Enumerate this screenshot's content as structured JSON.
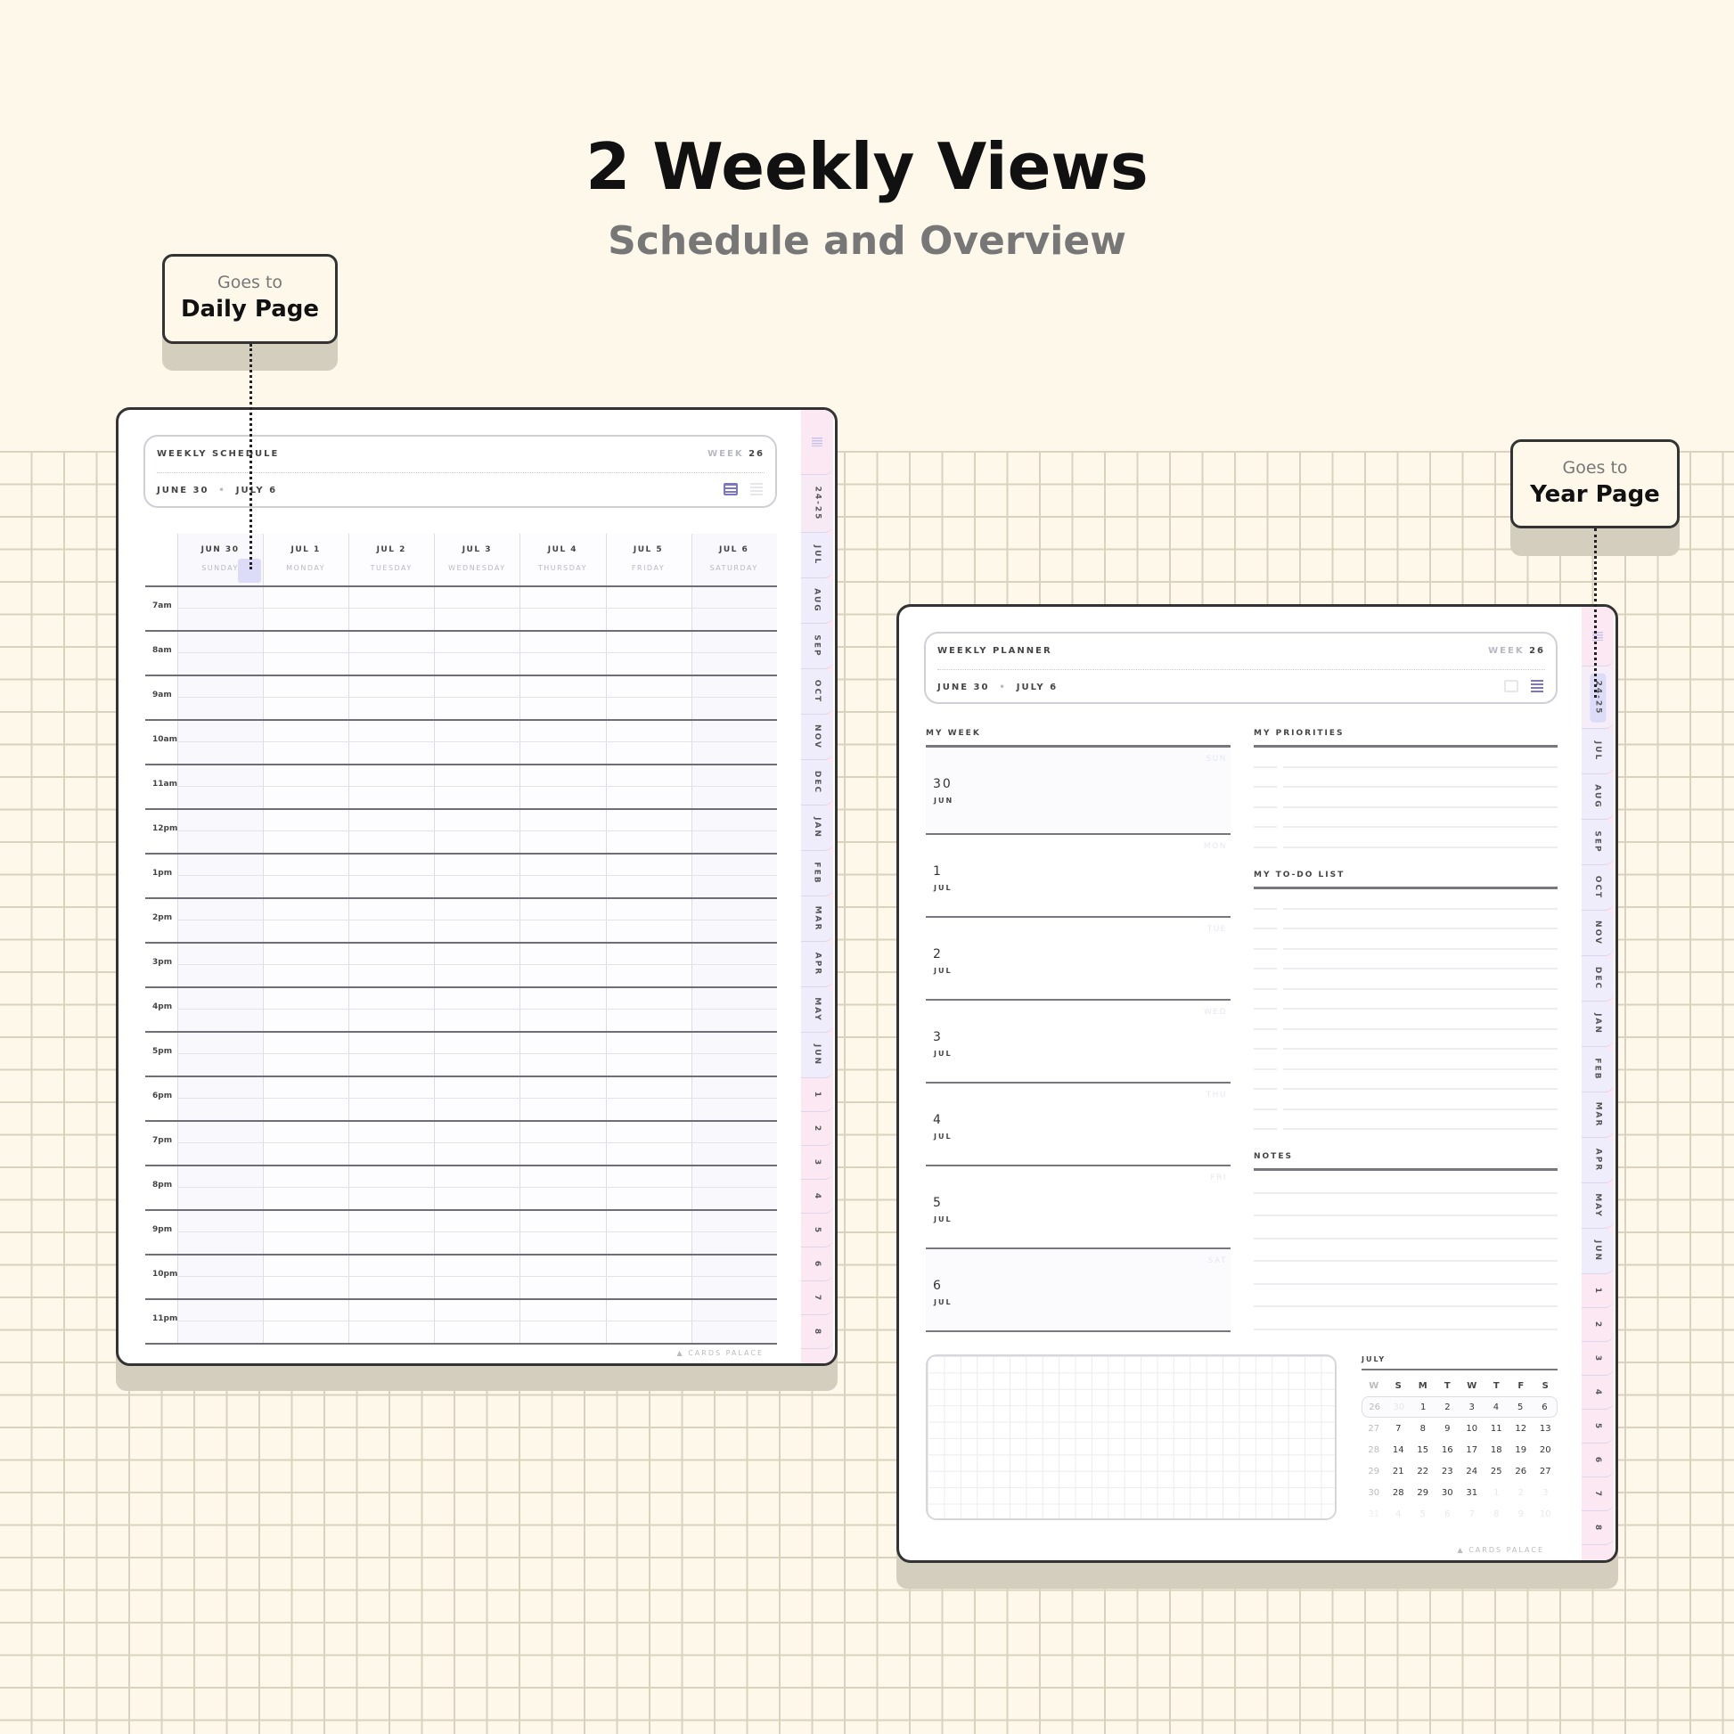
{
  "heading": {
    "title": "2 Weekly Views",
    "subtitle": "Schedule and Overview"
  },
  "callouts": [
    {
      "small": "Goes to",
      "large": "Daily Page"
    },
    {
      "small": "Goes to",
      "large": "Year Page"
    }
  ],
  "tabs": {
    "year": "24-25",
    "months": [
      "JUL",
      "AUG",
      "SEP",
      "OCT",
      "NOV",
      "DEC",
      "JAN",
      "FEB",
      "MAR",
      "APR",
      "MAY",
      "JUN"
    ],
    "numbers": [
      "1",
      "2",
      "3",
      "4",
      "5",
      "6",
      "7",
      "8"
    ],
    "menu_icon": "menu-lines-icon"
  },
  "colors": {
    "background": "#fdf8ea",
    "accent": "#7a76c4",
    "tab_pink": "#fbe8f2",
    "tab_lavender": "#efedfb",
    "highlight": "#dcdcf8"
  },
  "schedule": {
    "title": "WEEKLY SCHEDULE",
    "week_label": "WEEK",
    "week_number": "26",
    "start": "JUNE 30",
    "end": "JULY 6",
    "view_icons": [
      "schedule-view-icon",
      "overview-view-icon"
    ],
    "days": [
      {
        "date": "JUN 30",
        "name": "SUNDAY"
      },
      {
        "date": "JUL 1",
        "name": "MONDAY"
      },
      {
        "date": "JUL 2",
        "name": "TUESDAY"
      },
      {
        "date": "JUL 3",
        "name": "WEDNESDAY"
      },
      {
        "date": "JUL 4",
        "name": "THURSDAY"
      },
      {
        "date": "JUL 5",
        "name": "FRIDAY"
      },
      {
        "date": "JUL 6",
        "name": "SATURDAY"
      }
    ],
    "hours": [
      "7am",
      "8am",
      "9am",
      "10am",
      "11am",
      "12pm",
      "1pm",
      "2pm",
      "3pm",
      "4pm",
      "5pm",
      "6pm",
      "7pm",
      "8pm",
      "9pm",
      "10pm",
      "11pm"
    ],
    "brand": "CARDS PALACE"
  },
  "planner": {
    "title": "WEEKLY PLANNER",
    "week_label": "WEEK",
    "week_number": "26",
    "start": "JUNE 30",
    "end": "JULY 6",
    "my_week": "MY WEEK",
    "priorities": "MY PRIORITIES",
    "todo": "MY TO-DO LIST",
    "notes": "NOTES",
    "days": [
      {
        "num": "30",
        "mon": "JUN",
        "wd": "SUN"
      },
      {
        "num": "1",
        "mon": "JUL",
        "wd": "MON"
      },
      {
        "num": "2",
        "mon": "JUL",
        "wd": "TUE"
      },
      {
        "num": "3",
        "mon": "JUL",
        "wd": "WED"
      },
      {
        "num": "4",
        "mon": "JUL",
        "wd": "THU"
      },
      {
        "num": "5",
        "mon": "JUL",
        "wd": "FRI"
      },
      {
        "num": "6",
        "mon": "JUL",
        "wd": "SAT"
      }
    ],
    "calendar": {
      "month": "JULY",
      "headers": [
        "W",
        "S",
        "M",
        "T",
        "W",
        "T",
        "F",
        "S"
      ],
      "weeks": [
        {
          "w": "26",
          "days": [
            [
              "30",
              1
            ],
            [
              "1",
              0
            ],
            [
              "2",
              0
            ],
            [
              "3",
              0
            ],
            [
              "4",
              0
            ],
            [
              "5",
              0
            ],
            [
              "6",
              0
            ]
          ],
          "current": true
        },
        {
          "w": "27",
          "days": [
            [
              "7",
              0
            ],
            [
              "8",
              0
            ],
            [
              "9",
              0
            ],
            [
              "10",
              0
            ],
            [
              "11",
              0
            ],
            [
              "12",
              0
            ],
            [
              "13",
              0
            ]
          ]
        },
        {
          "w": "28",
          "days": [
            [
              "14",
              0
            ],
            [
              "15",
              0
            ],
            [
              "16",
              0
            ],
            [
              "17",
              0
            ],
            [
              "18",
              0
            ],
            [
              "19",
              0
            ],
            [
              "20",
              0
            ]
          ]
        },
        {
          "w": "29",
          "days": [
            [
              "21",
              0
            ],
            [
              "22",
              0
            ],
            [
              "23",
              0
            ],
            [
              "24",
              0
            ],
            [
              "25",
              0
            ],
            [
              "26",
              0
            ],
            [
              "27",
              0
            ]
          ]
        },
        {
          "w": "30",
          "days": [
            [
              "28",
              0
            ],
            [
              "29",
              0
            ],
            [
              "30",
              0
            ],
            [
              "31",
              0
            ],
            [
              "1",
              1
            ],
            [
              "2",
              1
            ],
            [
              "3",
              1
            ]
          ]
        },
        {
          "w": "31",
          "days": [
            [
              "4",
              1
            ],
            [
              "5",
              1
            ],
            [
              "6",
              1
            ],
            [
              "7",
              1
            ],
            [
              "8",
              1
            ],
            [
              "9",
              1
            ],
            [
              "10",
              1
            ]
          ],
          "faded_w": true
        }
      ]
    },
    "brand": "CARDS PALACE"
  }
}
